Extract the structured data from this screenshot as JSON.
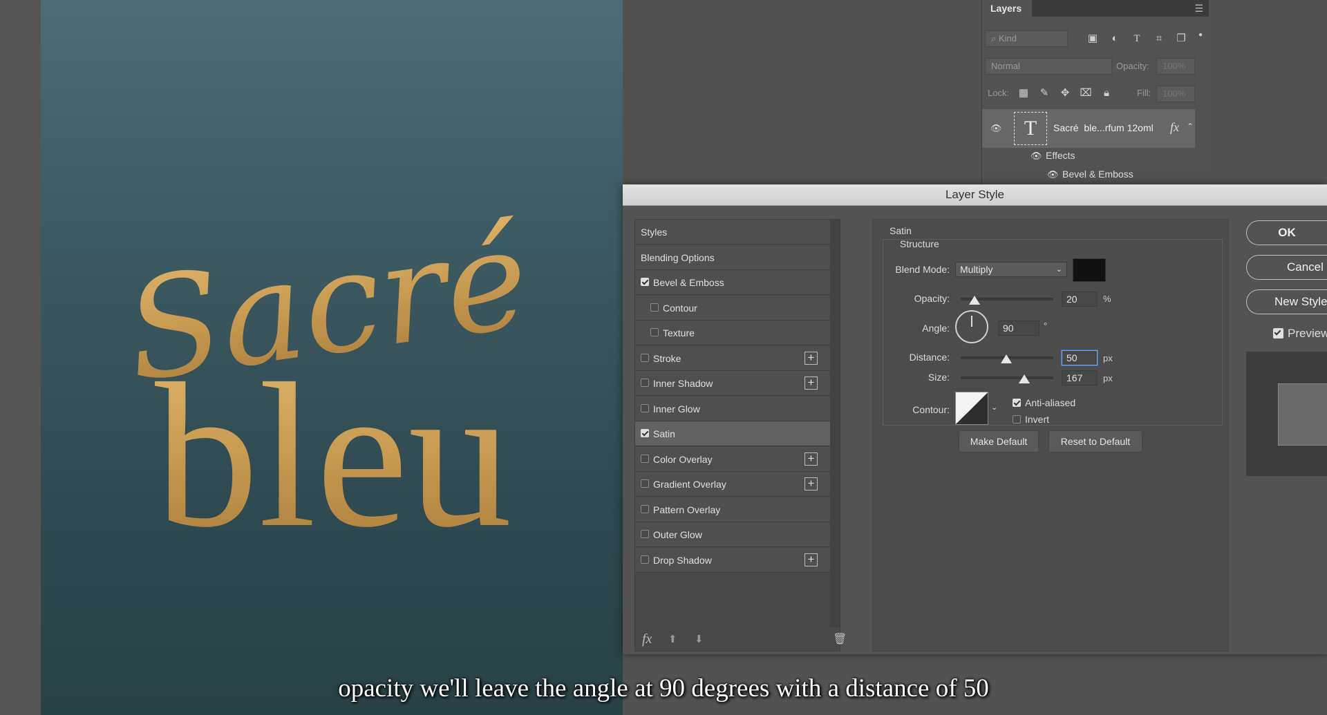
{
  "artwork": {
    "word1": "Sacré",
    "word2": "bleu"
  },
  "layers_panel": {
    "tab": "Layers",
    "filter_kind": "Kind",
    "blend_mode": "Normal",
    "opacity_label": "Opacity:",
    "opacity_value": "100%",
    "lock_label": "Lock:",
    "fill_label": "Fill:",
    "fill_value": "100%",
    "layer_name": "Sacré  ble...rfum 12oml",
    "fx_glyph": "fx",
    "effects_label": "Effects",
    "effect_bevel": "Bevel & Emboss"
  },
  "dialog": {
    "title": "Layer Style",
    "styles": [
      {
        "label": "Styles",
        "checkbox": false,
        "checked": false,
        "indent": false,
        "plus": false,
        "selected": false
      },
      {
        "label": "Blending Options",
        "checkbox": false,
        "checked": false,
        "indent": false,
        "plus": false,
        "selected": false
      },
      {
        "label": "Bevel & Emboss",
        "checkbox": true,
        "checked": true,
        "indent": false,
        "plus": false,
        "selected": false
      },
      {
        "label": "Contour",
        "checkbox": true,
        "checked": false,
        "indent": true,
        "plus": false,
        "selected": false
      },
      {
        "label": "Texture",
        "checkbox": true,
        "checked": false,
        "indent": true,
        "plus": false,
        "selected": false
      },
      {
        "label": "Stroke",
        "checkbox": true,
        "checked": false,
        "indent": false,
        "plus": true,
        "selected": false
      },
      {
        "label": "Inner Shadow",
        "checkbox": true,
        "checked": false,
        "indent": false,
        "plus": true,
        "selected": false
      },
      {
        "label": "Inner Glow",
        "checkbox": true,
        "checked": false,
        "indent": false,
        "plus": false,
        "selected": false
      },
      {
        "label": "Satin",
        "checkbox": true,
        "checked": true,
        "indent": false,
        "plus": false,
        "selected": true
      },
      {
        "label": "Color Overlay",
        "checkbox": true,
        "checked": false,
        "indent": false,
        "plus": true,
        "selected": false
      },
      {
        "label": "Gradient Overlay",
        "checkbox": true,
        "checked": false,
        "indent": false,
        "plus": true,
        "selected": false
      },
      {
        "label": "Pattern Overlay",
        "checkbox": true,
        "checked": false,
        "indent": false,
        "plus": false,
        "selected": false
      },
      {
        "label": "Outer Glow",
        "checkbox": true,
        "checked": false,
        "indent": false,
        "plus": false,
        "selected": false
      },
      {
        "label": "Drop Shadow",
        "checkbox": true,
        "checked": false,
        "indent": false,
        "plus": true,
        "selected": false
      }
    ],
    "footer_fx": "fx",
    "satin": {
      "section": "Satin",
      "group": "Structure",
      "blend_mode_label": "Blend Mode:",
      "blend_mode_value": "Multiply",
      "color": "#111111",
      "opacity_label": "Opacity:",
      "opacity_value": "20",
      "opacity_unit": "%",
      "angle_label": "Angle:",
      "angle_value": "90",
      "angle_unit": "°",
      "distance_label": "Distance:",
      "distance_value": "50",
      "distance_unit": "px",
      "size_label": "Size:",
      "size_value": "167",
      "size_unit": "px",
      "contour_label": "Contour:",
      "anti_aliased": "Anti-aliased",
      "invert": "Invert",
      "make_default": "Make Default",
      "reset_default": "Reset to Default"
    },
    "buttons": {
      "ok": "OK",
      "cancel": "Cancel",
      "new_style": "New Style...",
      "preview": "Preview"
    }
  },
  "subtitle": "opacity we'll leave the angle at 90 degrees with a distance of 50"
}
